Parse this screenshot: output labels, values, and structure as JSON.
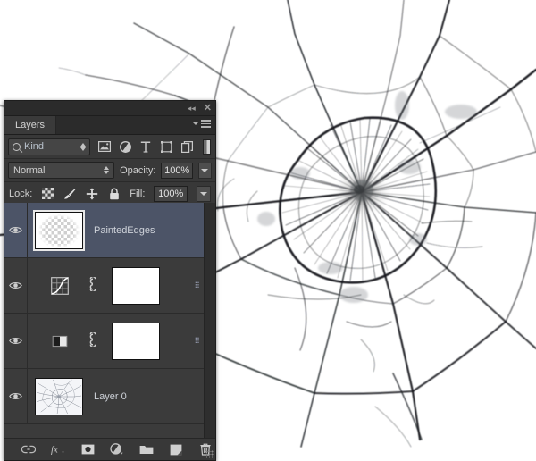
{
  "app": {
    "panel_title": "Layers",
    "collapse_icon": "double-left-chevron-icon",
    "close_icon": "close-icon"
  },
  "filter_row": {
    "kind_label": "Kind",
    "search_icon": "search-icon",
    "filter_icons": [
      {
        "name": "pixel-layer-filter-icon",
        "title": "Pixel layers"
      },
      {
        "name": "adjustment-layer-filter-icon",
        "title": "Adjustment layers"
      },
      {
        "name": "type-layer-filter-icon",
        "title": "Type layers"
      },
      {
        "name": "shape-layer-filter-icon",
        "title": "Shape layers"
      },
      {
        "name": "smart-object-filter-icon",
        "title": "Smart objects"
      }
    ],
    "toggle_name": "filter-enable-toggle"
  },
  "blend_row": {
    "blend_mode": "Normal",
    "opacity_label": "Opacity:",
    "opacity_value": "100%"
  },
  "lock_row": {
    "lock_label": "Lock:",
    "lock_icons": [
      {
        "name": "lock-transparent-pixels-icon"
      },
      {
        "name": "lock-image-pixels-brush-icon"
      },
      {
        "name": "lock-position-move-icon"
      },
      {
        "name": "lock-all-padlock-icon"
      }
    ],
    "fill_label": "Fill:",
    "fill_value": "100%"
  },
  "layers": [
    {
      "name": "PaintedEdges",
      "selected": true,
      "visible": true,
      "thumb_type": "transparent-pixels",
      "has_mask": false,
      "has_link": false,
      "dots": ""
    },
    {
      "name": "",
      "selected": false,
      "visible": true,
      "thumb_type": "curves-adjustment",
      "has_mask": true,
      "has_link": true,
      "dots": "⠿"
    },
    {
      "name": "",
      "selected": false,
      "visible": true,
      "thumb_type": "gradient-map-adjustment",
      "has_mask": true,
      "has_link": true,
      "dots": "⠿"
    },
    {
      "name": "Layer 0",
      "selected": false,
      "visible": true,
      "thumb_type": "cracked-glass-image",
      "has_mask": false,
      "has_link": false,
      "dots": ""
    }
  ],
  "footer_icons": [
    {
      "name": "link-layers-icon"
    },
    {
      "name": "layer-style-fx-icon"
    },
    {
      "name": "add-layer-mask-icon"
    },
    {
      "name": "new-adjustment-layer-icon"
    },
    {
      "name": "new-group-folder-icon"
    },
    {
      "name": "new-layer-icon"
    },
    {
      "name": "delete-layer-trash-icon"
    }
  ],
  "canvas": {
    "image_name": "cracked-glass-photo",
    "background_color": "#ffffff",
    "crack_color": "#111111"
  },
  "colors": {
    "panel_bg": "#383838",
    "list_bg": "#3b3b3b",
    "selected_row": "#4c5467",
    "text": "#cfcfcf",
    "title_bar": "#2b2b2b"
  }
}
